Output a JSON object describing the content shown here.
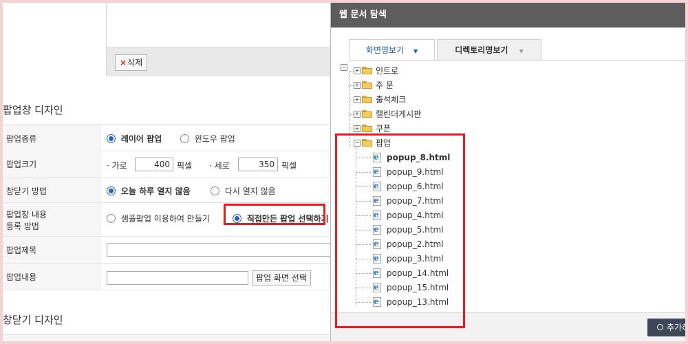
{
  "left": {
    "delete_label": "삭제",
    "section1_title": "팝업창 디자인",
    "popup_type": {
      "label": "팝업종류",
      "opt_layer": "레이어 팝업",
      "opt_window": "윈도우 팝업"
    },
    "popup_size": {
      "label": "팝업크기",
      "w_label": "· 가로",
      "w_value": "400",
      "unit": "픽셀",
      "h_label": "· 세로",
      "h_value": "350"
    },
    "close_method": {
      "label": "창닫기 방법",
      "opt1": "오늘 하루 열지 않음",
      "opt2": "다시 열지 않음"
    },
    "register": {
      "label1": "팝업창 내용",
      "label2": "등록 방법",
      "opt1": "샘플팝업 이용하여 만들기",
      "opt2": "직접만든 팝업 선택하기"
    },
    "popup_title": {
      "label": "팝업제목"
    },
    "popup_content": {
      "label": "팝업내용",
      "button": "팝업 화면 선택"
    },
    "section2_title": "창닫기 디자인"
  },
  "dialog": {
    "title": "웹 문서 탐색",
    "tab_screen": "화면명보기",
    "tab_dir": "디렉토리명보기",
    "folders": [
      "인트로",
      "주 문",
      "출석체크",
      "캘린더게시판",
      "쿠폰"
    ],
    "open_folder": "팝업",
    "files": [
      "popup_8.html",
      "popup_9.html",
      "popup_6.html",
      "popup_7.html",
      "popup_4.html",
      "popup_5.html",
      "popup_2.html",
      "popup_3.html",
      "popup_14.html",
      "popup_15.html",
      "popup_13.html"
    ],
    "selected_file_index": 0,
    "add_button": "추가하"
  },
  "colors": {
    "highlight": "#e02020",
    "dialog_header": "#5d5d5d",
    "radio_on": "#2464c8"
  }
}
